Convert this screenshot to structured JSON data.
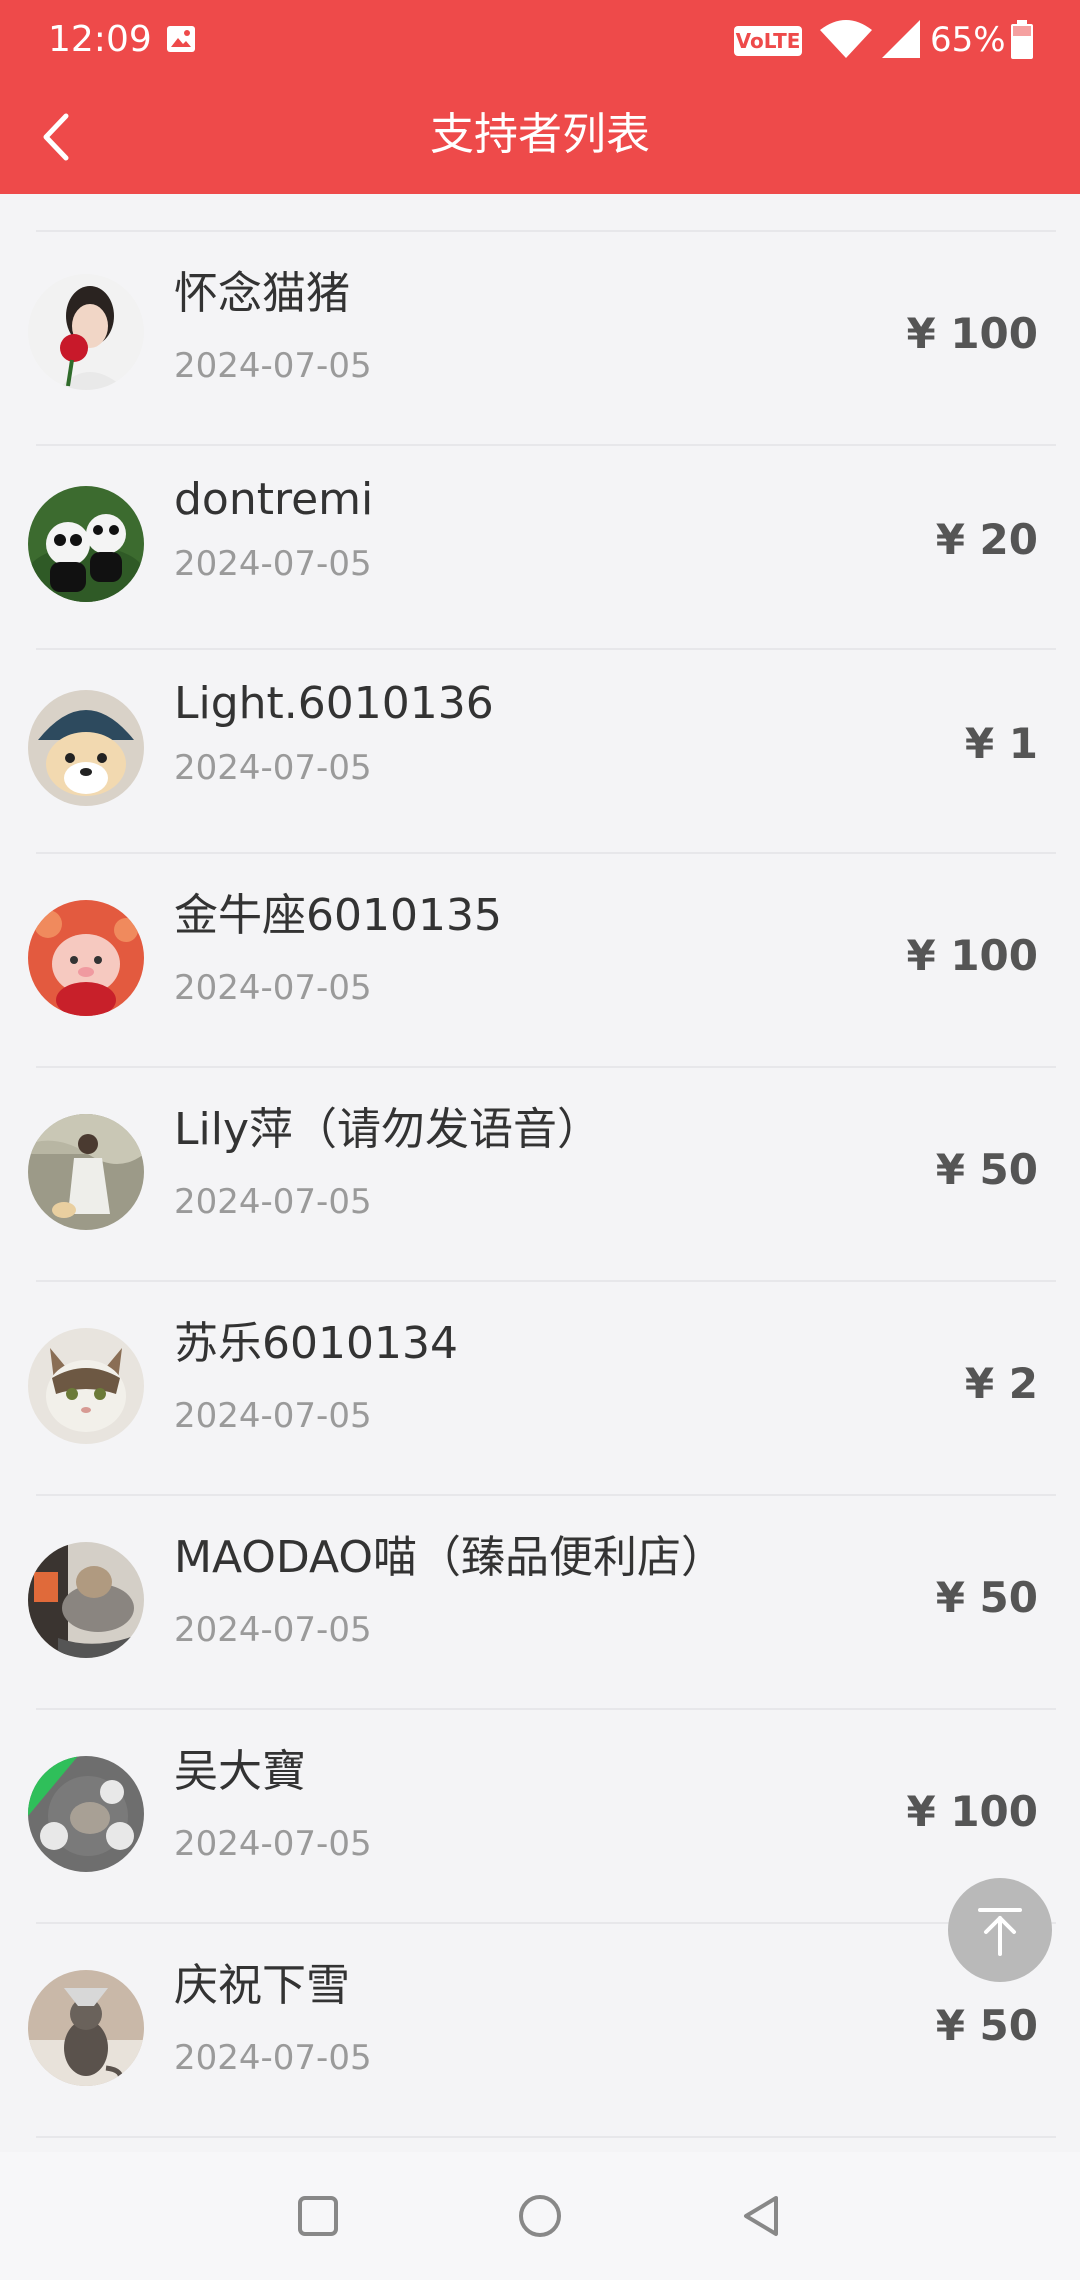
{
  "status_bar": {
    "time": "12:09",
    "network_badge": "VoLTE",
    "battery": "65%",
    "icons": [
      "image-icon",
      "wifi-icon",
      "cellular-signal-icon",
      "battery-icon"
    ]
  },
  "header": {
    "title": "支持者列表",
    "back_icon": "chevron-left-icon",
    "background_color": "#ee4a4a"
  },
  "supporters": [
    {
      "name": "怀念猫猪",
      "date": "2024-07-05",
      "amount": "¥ 100"
    },
    {
      "name": "dontremi",
      "date": "2024-07-05",
      "amount": "¥ 20"
    },
    {
      "name": "Light.6010136",
      "date": "2024-07-05",
      "amount": "¥ 1"
    },
    {
      "name": "金牛座6010135",
      "date": "2024-07-05",
      "amount": "¥ 100"
    },
    {
      "name": "Lily萍（请勿发语音）",
      "date": "2024-07-05",
      "amount": "¥ 50"
    },
    {
      "name": "苏乐6010134",
      "date": "2024-07-05",
      "amount": "¥ 2"
    },
    {
      "name": "MAODAO喵（臻品便利店）",
      "date": "2024-07-05",
      "amount": "¥ 50"
    },
    {
      "name": "吴大寶",
      "date": "2024-07-05",
      "amount": "¥ 100"
    },
    {
      "name": "庆祝下雪",
      "date": "2024-07-05",
      "amount": "¥ 50"
    }
  ],
  "floating_button": {
    "icon": "arrow-up-to-top-icon"
  },
  "nav_bar": {
    "icons": [
      "recent-apps-icon",
      "home-icon",
      "back-triangle-icon"
    ]
  }
}
